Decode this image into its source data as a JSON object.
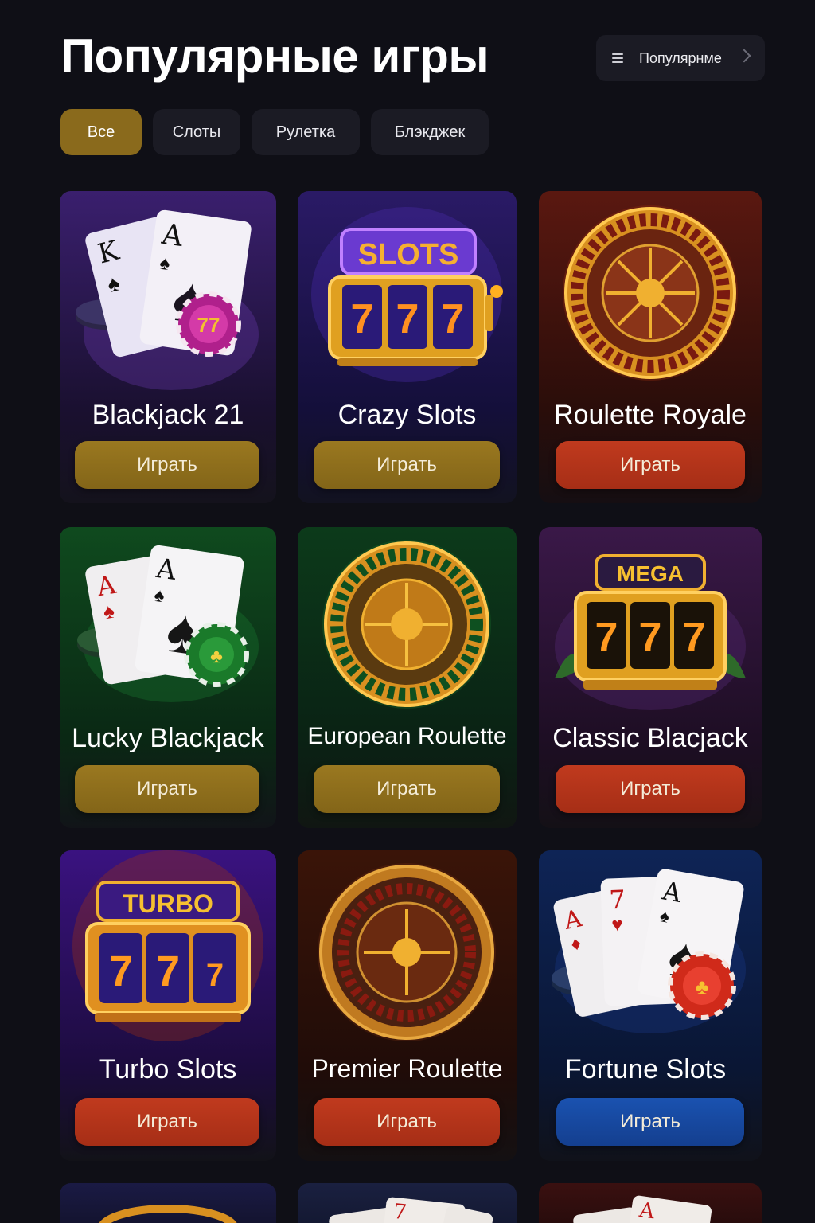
{
  "header": {
    "title": "Популярные игры",
    "sort_label": "Популярнме"
  },
  "tabs": [
    {
      "label": "Все",
      "active": true
    },
    {
      "label": "Слоты",
      "active": false
    },
    {
      "label": "Рулетка",
      "active": false
    },
    {
      "label": "Блэкджек",
      "active": false
    }
  ],
  "games": [
    {
      "name": "Blackjack 21",
      "button": "Играть",
      "button_color": "#8a6a1c",
      "art": "cards-icon",
      "bg": "#3a1f6e"
    },
    {
      "name": "Crazy Slots",
      "button": "Играть",
      "button_color": "#8a6a1c",
      "art": "slot-machine-icon",
      "bg": "#2a1a66"
    },
    {
      "name": "Roulette Royale",
      "button": "Играть",
      "button_color": "#b2321a",
      "art": "roulette-wheel-icon",
      "bg": "#5a1810"
    },
    {
      "name": "Lucky Blackjack",
      "button": "Играть",
      "button_color": "#8a6a1c",
      "art": "cards-icon",
      "bg": "#0f4a1e"
    },
    {
      "name": "European Roulette",
      "button": "Играть",
      "button_color": "#8a6a1c",
      "art": "roulette-wheel-icon",
      "bg": "#0c3a1a"
    },
    {
      "name": "Classic Blacjack",
      "button": "Играть",
      "button_color": "#b2321a",
      "art": "slot-machine-icon",
      "bg": "#3a1848"
    },
    {
      "name": "Turbo Slots",
      "button": "Играть",
      "button_color": "#b2321a",
      "art": "slot-machine-icon",
      "bg": "#3a1280"
    },
    {
      "name": "Premier Roulette",
      "button": "Играть",
      "button_color": "#b2321a",
      "art": "roulette-wheel-icon",
      "bg": "#3a1408"
    },
    {
      "name": "Fortune Slots",
      "button": "Играть",
      "button_color": "#1a4fa8",
      "art": "cards-icon",
      "bg": "#0e2456"
    }
  ],
  "slot_labels": [
    "SLOTS",
    "MEGA",
    "TURBO"
  ]
}
